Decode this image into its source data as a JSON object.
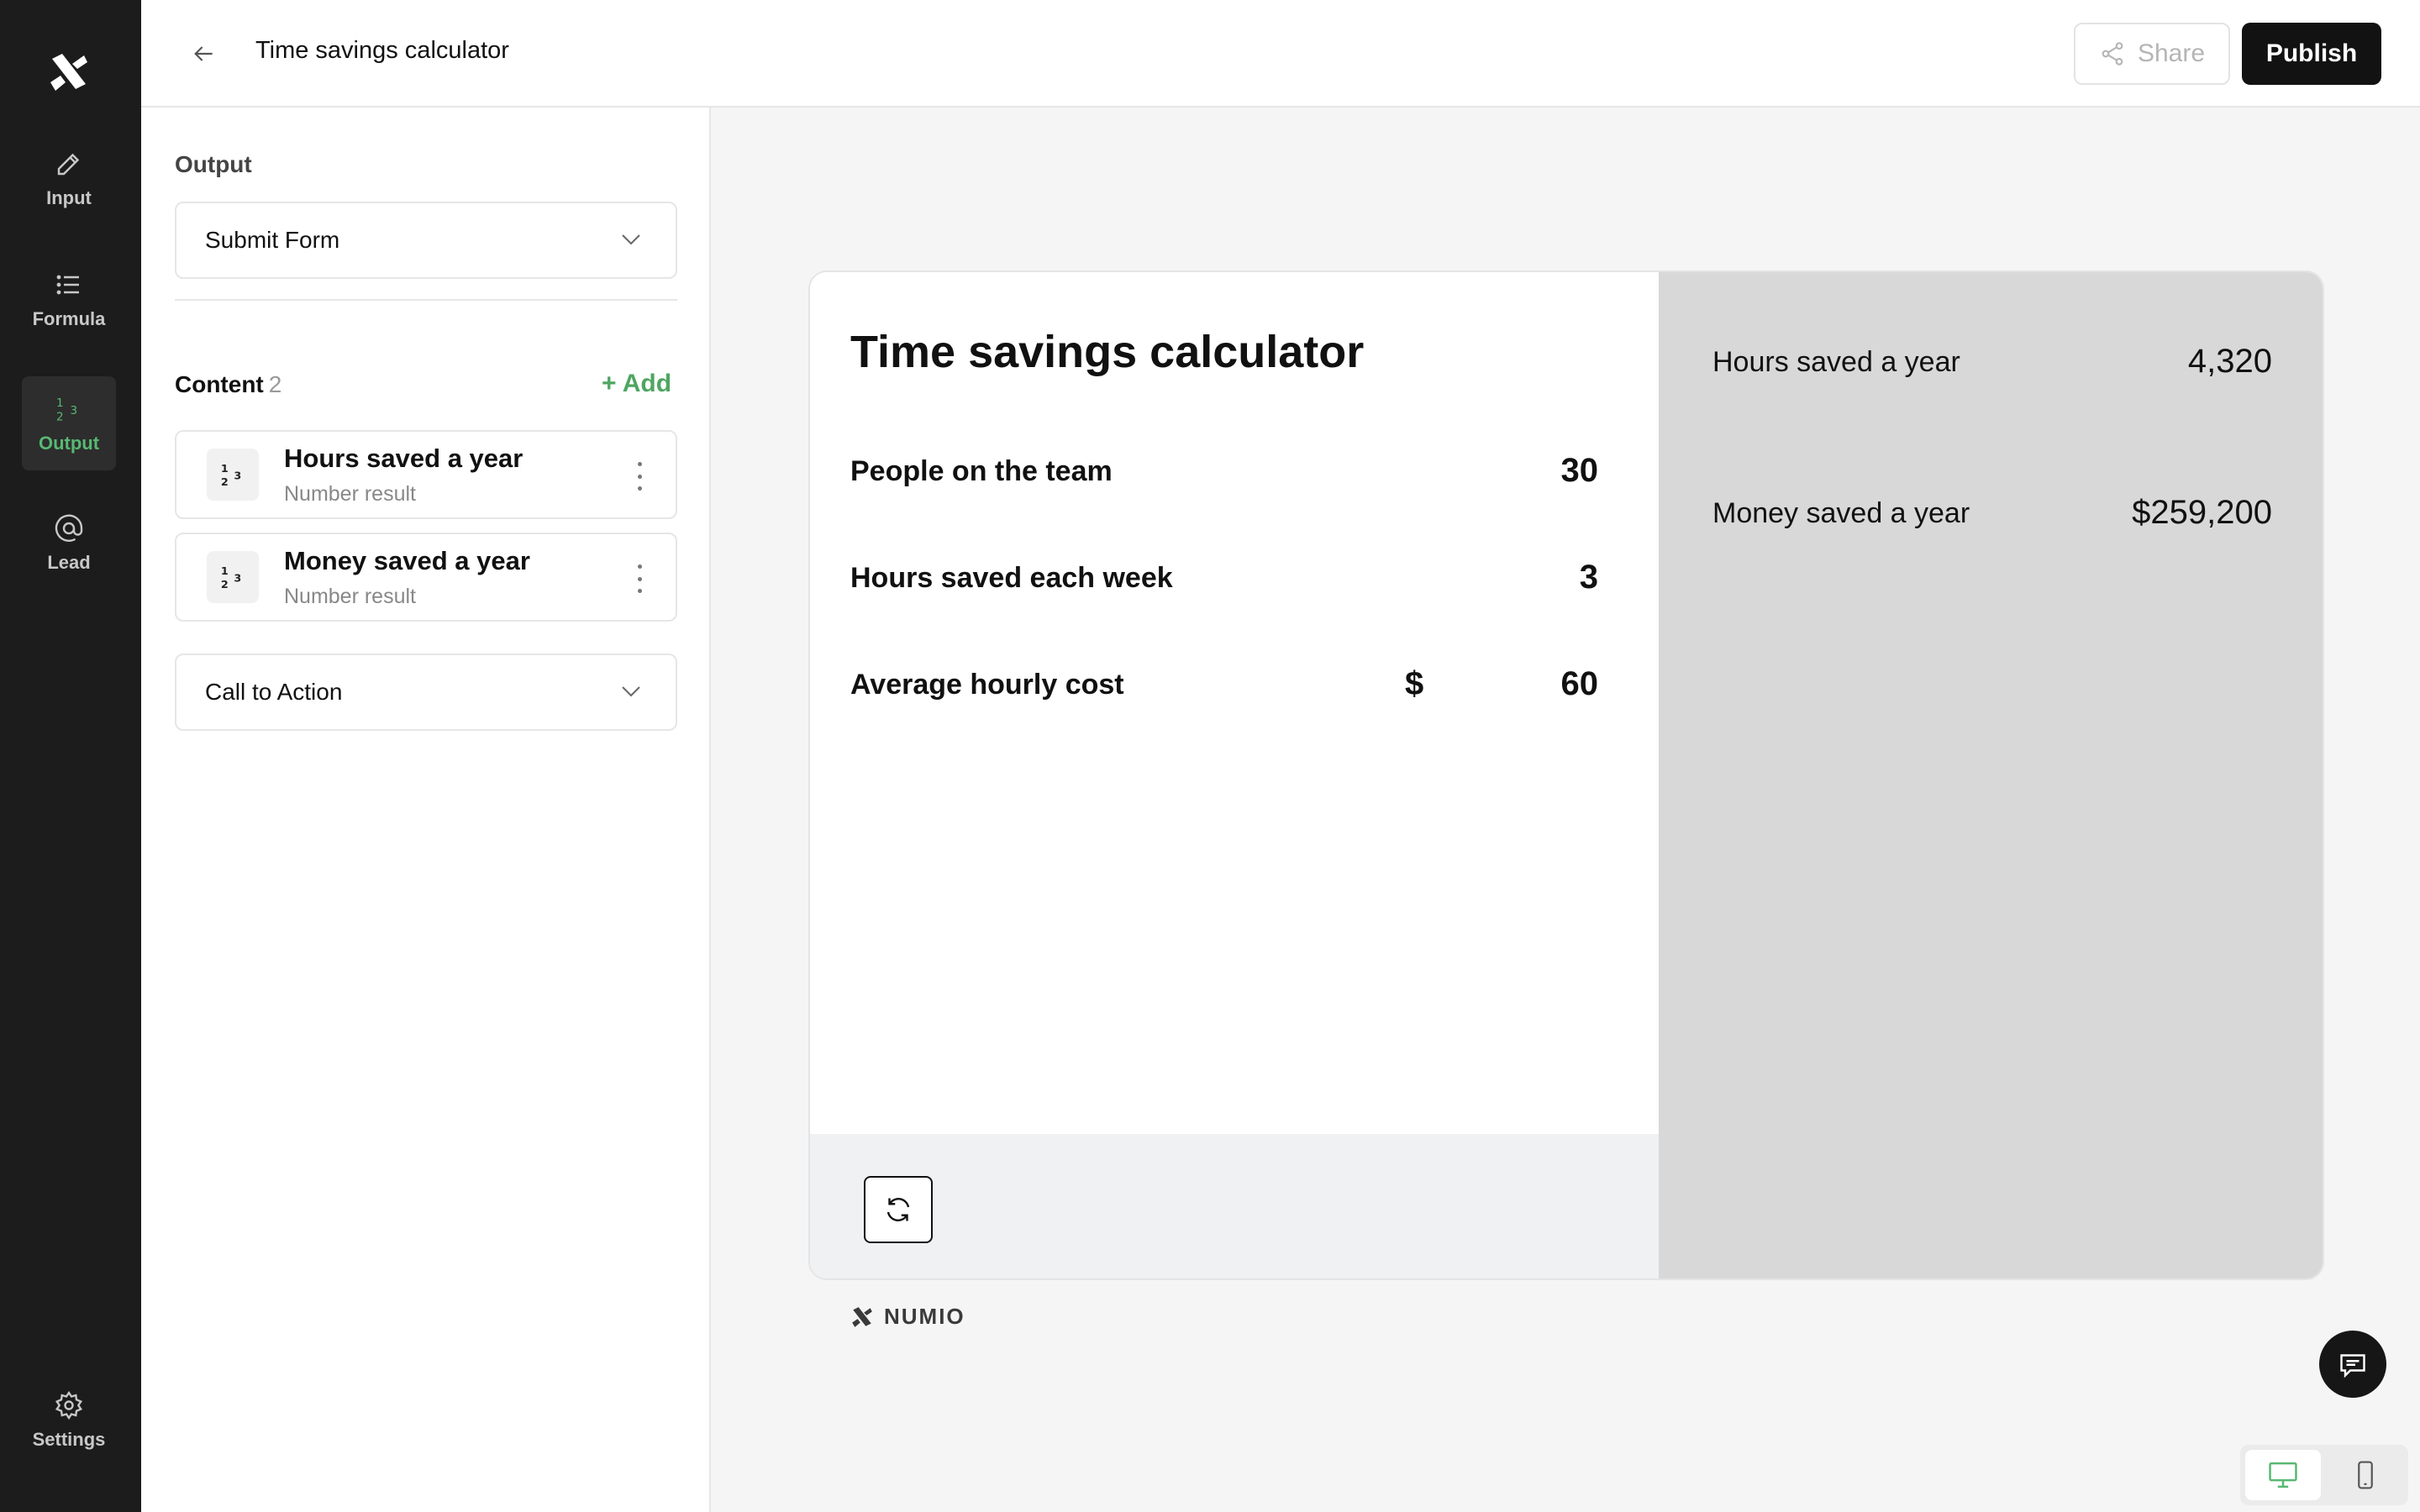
{
  "app": {
    "title": "Time savings calculator",
    "share_label": "Share",
    "publish_label": "Publish"
  },
  "nav": {
    "items": [
      {
        "label": "Input",
        "icon": "pencil-icon"
      },
      {
        "label": "Formula",
        "icon": "list-icon"
      },
      {
        "label": "Output",
        "icon": "numbers-icon",
        "active": true
      },
      {
        "label": "Lead",
        "icon": "at-sign-icon"
      }
    ],
    "settings_label": "Settings"
  },
  "panel": {
    "output_label": "Output",
    "output_select": "Submit Form",
    "content_label": "Content",
    "content_count": "2",
    "add_label": "+ Add",
    "results": [
      {
        "title": "Hours saved a year",
        "subtitle": "Number result"
      },
      {
        "title": "Money saved a year",
        "subtitle": "Number result"
      }
    ],
    "cta_select": "Call to Action"
  },
  "preview": {
    "title": "Time savings calculator",
    "inputs": [
      {
        "label": "People on the team",
        "prefix": "",
        "value": "30"
      },
      {
        "label": "Hours saved each week",
        "prefix": "",
        "value": "3"
      },
      {
        "label": "Average hourly cost",
        "prefix": "$",
        "value": "60"
      }
    ],
    "outputs": [
      {
        "label": "Hours saved a year",
        "value": "4,320"
      },
      {
        "label": "Money saved a year",
        "value": "$259,200"
      }
    ],
    "brand": "NUMIO"
  },
  "colors": {
    "accent": "#58b872",
    "rail_bg": "#1c1c1c",
    "publish_bg": "#121212",
    "result_panel_bg": "#d8d8d8"
  }
}
